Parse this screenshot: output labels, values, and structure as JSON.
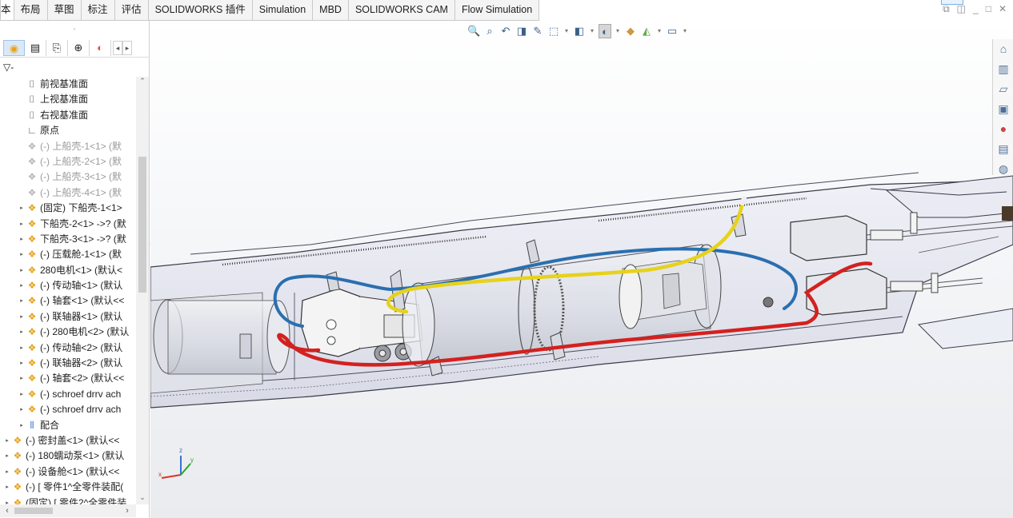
{
  "command_tabs": {
    "first_partial": "本",
    "tabs": [
      "布局",
      "草图",
      "标注",
      "评估",
      "SOLIDWORKS 插件",
      "Simulation",
      "MBD",
      "SOLIDWORKS CAM",
      "Flow Simulation"
    ]
  },
  "window_controls": [
    "restore-icon",
    "tile-icon",
    "minimize-icon",
    "maximize-icon",
    "close-icon"
  ],
  "feature_manager": {
    "tabs": [
      "feature-tree-icon",
      "property-manager-icon",
      "configuration-manager-icon",
      "dimxpert-icon",
      "display-manager-icon"
    ],
    "filter_label": "▽-",
    "tree": [
      {
        "label": "前视基准面",
        "type": "plane",
        "indent": 1,
        "dim": false
      },
      {
        "label": "上视基准面",
        "type": "plane",
        "indent": 1,
        "dim": false
      },
      {
        "label": "右视基准面",
        "type": "plane",
        "indent": 1,
        "dim": false
      },
      {
        "label": "原点",
        "type": "origin",
        "indent": 1,
        "dim": false
      },
      {
        "label": "(-) 上船壳-1<1> (默",
        "type": "part",
        "indent": 1,
        "dim": true
      },
      {
        "label": "(-) 上船壳-2<1> (默",
        "type": "part",
        "indent": 1,
        "dim": true
      },
      {
        "label": "(-) 上船壳-3<1> (默",
        "type": "part",
        "indent": 1,
        "dim": true
      },
      {
        "label": "(-) 上船壳-4<1> (默",
        "type": "part",
        "indent": 1,
        "dim": true
      },
      {
        "label": "(固定) 下船壳-1<1>",
        "type": "part",
        "indent": 1,
        "dim": false,
        "expand": true
      },
      {
        "label": "下船壳-2<1> ->? (默",
        "type": "part",
        "indent": 1,
        "dim": false,
        "expand": true
      },
      {
        "label": "下船壳-3<1> ->? (默",
        "type": "part",
        "indent": 1,
        "dim": false,
        "expand": true
      },
      {
        "label": "(-) 压载舱-1<1> (默",
        "type": "part",
        "indent": 1,
        "dim": false,
        "expand": true
      },
      {
        "label": "280电机<1> (默认<",
        "type": "part",
        "indent": 1,
        "dim": false,
        "expand": true
      },
      {
        "label": "(-) 传动轴<1> (默认",
        "type": "part",
        "indent": 1,
        "dim": false,
        "expand": true
      },
      {
        "label": "(-) 轴套<1> (默认<<",
        "type": "part",
        "indent": 1,
        "dim": false,
        "expand": true
      },
      {
        "label": "(-) 联轴器<1> (默认",
        "type": "part",
        "indent": 1,
        "dim": false,
        "expand": true
      },
      {
        "label": "(-) 280电机<2> (默认",
        "type": "part",
        "indent": 1,
        "dim": false,
        "expand": true
      },
      {
        "label": "(-) 传动轴<2> (默认",
        "type": "part",
        "indent": 1,
        "dim": false,
        "expand": true
      },
      {
        "label": "(-) 联轴器<2> (默认",
        "type": "part",
        "indent": 1,
        "dim": false,
        "expand": true
      },
      {
        "label": "(-) 轴套<2> (默认<<",
        "type": "part",
        "indent": 1,
        "dim": false,
        "expand": true
      },
      {
        "label": "(-) schroef drrv ach",
        "type": "part",
        "indent": 1,
        "dim": false,
        "expand": true
      },
      {
        "label": "(-) schroef drrv ach",
        "type": "part",
        "indent": 1,
        "dim": false,
        "expand": true
      },
      {
        "label": "配合",
        "type": "mate",
        "indent": 1,
        "dim": false,
        "expand": true
      },
      {
        "label": "(-) 密封盖<1> (默认<<",
        "type": "part",
        "indent": 0,
        "dim": false,
        "expand": true
      },
      {
        "label": "(-) 180蠕动泵<1> (默认",
        "type": "part",
        "indent": 0,
        "dim": false,
        "expand": true
      },
      {
        "label": "(-) 设备舱<1> (默认<<",
        "type": "part",
        "indent": 0,
        "dim": false,
        "expand": true
      },
      {
        "label": "(-) [ 零件1^全零件装配(",
        "type": "part",
        "indent": 0,
        "dim": false,
        "expand": true
      },
      {
        "label": "(固定) [ 零件2^全零件装",
        "type": "part",
        "indent": 0,
        "dim": false,
        "expand": true
      }
    ]
  },
  "heads_up_toolbar": [
    "zoom-to-fit-icon",
    "zoom-to-area-icon",
    "previous-view-icon",
    "section-view-icon",
    "dynamic-annotation-icon",
    "view-orientation-icon",
    "display-style-icon",
    "hide-show-icon",
    "edit-appearance-icon",
    "apply-scene-icon",
    "view-settings-icon"
  ],
  "task_pane": [
    "home-icon",
    "design-library-icon",
    "file-explorer-icon",
    "view-palette-icon",
    "appearances-icon",
    "custom-properties-icon",
    "solidworks-forum-icon"
  ],
  "triad": {
    "x": "x",
    "y": "y",
    "z": "z"
  },
  "colors": {
    "wire_yellow": "#e6d21a",
    "wire_blue": "#2a6fb0",
    "wire_red": "#d3211f",
    "hull": "#e4e6ef",
    "accent": "#3a7bd5"
  }
}
